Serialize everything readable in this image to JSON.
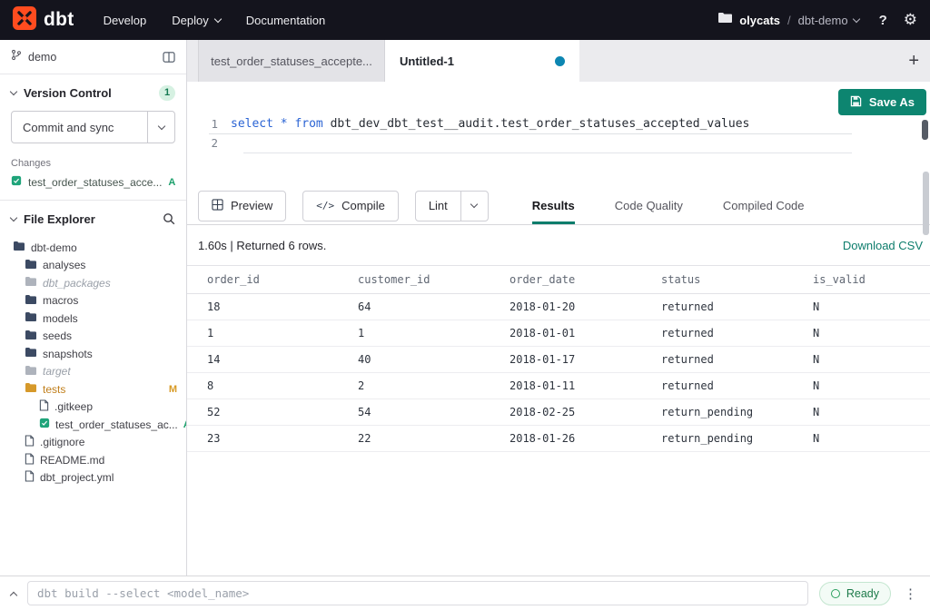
{
  "colors": {
    "nav_bg": "#14141d",
    "brand_orange": "#ff4c1f",
    "accent_teal": "#0d8570",
    "link_teal": "#0d7d6c",
    "added_green": "#1ca06c",
    "modified_amber": "#d89a25",
    "unsaved_dot_blue": "#0d86b2",
    "ready_green": "#1c7a49"
  },
  "icons": {
    "compile_glyph": "</>",
    "gear": "⚙",
    "kebab": "⋮",
    "plus": "+",
    "help": "?"
  },
  "topnav": {
    "logo_text": "dbt",
    "develop": "Develop",
    "deploy": "Deploy",
    "documentation": "Documentation",
    "account": "olycats",
    "path_separator": "/",
    "project": "dbt-demo"
  },
  "sidebar": {
    "branch_name": "demo",
    "version_control": {
      "title": "Version Control",
      "badge_count": "1",
      "commit_button_label": "Commit and sync",
      "changes_label": "Changes",
      "changed_file": {
        "name": "test_order_statuses_acce...",
        "status": "A"
      }
    },
    "file_explorer": {
      "title": "File Explorer",
      "tree": [
        {
          "name": "dbt-demo"
        },
        {
          "name": "analyses"
        },
        {
          "name": "dbt_packages"
        },
        {
          "name": "macros"
        },
        {
          "name": "models"
        },
        {
          "name": "seeds"
        },
        {
          "name": "snapshots"
        },
        {
          "name": "target"
        },
        {
          "name": "tests",
          "badge": "M"
        },
        {
          "name": ".gitkeep"
        },
        {
          "name": "test_order_statuses_ac...",
          "badge": "A"
        },
        {
          "name": ".gitignore"
        },
        {
          "name": "README.md"
        },
        {
          "name": "dbt_project.yml"
        }
      ]
    }
  },
  "editor_tabs": {
    "tabs": [
      {
        "label": "test_order_statuses_accepte..."
      },
      {
        "label": "Untitled-1"
      }
    ]
  },
  "editor": {
    "save_as_label": "Save As",
    "line_numbers": [
      "1",
      "2"
    ],
    "code_tokens": {
      "kw_select": "select",
      "star": "*",
      "kw_from": "from",
      "identifier": "dbt_dev_dbt_test__audit.test_order_statuses_accepted_values"
    }
  },
  "toolbar": {
    "preview_label": "Preview",
    "compile_label": "Compile",
    "lint_label": "Lint",
    "tabs": [
      {
        "label": "Results"
      },
      {
        "label": "Code Quality"
      },
      {
        "label": "Compiled Code"
      }
    ]
  },
  "results": {
    "summary": "1.60s | Returned 6 rows.",
    "download_csv": "Download CSV",
    "table": {
      "columns": [
        "order_id",
        "customer_id",
        "order_date",
        "status",
        "is_valid"
      ],
      "rows": [
        [
          "18",
          "64",
          "2018-01-20",
          "returned",
          "N"
        ],
        [
          "1",
          "1",
          "2018-01-01",
          "returned",
          "N"
        ],
        [
          "14",
          "40",
          "2018-01-17",
          "returned",
          "N"
        ],
        [
          "8",
          "2",
          "2018-01-11",
          "returned",
          "N"
        ],
        [
          "52",
          "54",
          "2018-02-25",
          "return_pending",
          "N"
        ],
        [
          "23",
          "22",
          "2018-01-26",
          "return_pending",
          "N"
        ]
      ]
    }
  },
  "command_bar": {
    "command": "dbt build --select <model_name>",
    "status": "Ready"
  }
}
